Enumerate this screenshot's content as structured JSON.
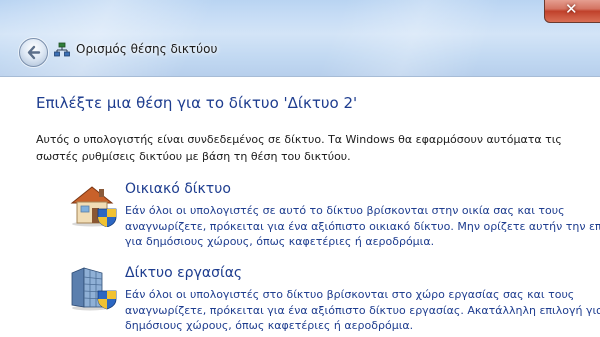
{
  "window": {
    "title": "Ορισμός θέσης δικτύου",
    "close_glyph": "✕"
  },
  "icons": {
    "back": "back-arrow-icon",
    "network": "network-icon",
    "home": "house-icon",
    "work": "office-building-icon",
    "shield": "security-shield-icon"
  },
  "main": {
    "heading": "Επιλέξτε μια θέση για το δίκτυο 'Δίκτυο  2'",
    "description": "Αυτός ο υπολογιστής είναι συνδεδεμένος σε δίκτυο. Τα Windows θα εφαρμόσουν αυτόματα τις σωστές ρυθμίσεις δικτύου με βάση τη θέση του δικτύου.",
    "options": [
      {
        "title": "Οικιακό δίκτυο",
        "lines": [
          "Εάν όλοι οι υπολογιστές σε αυτό το δίκτυο βρίσκονται στην οικία σας και τους",
          "αναγνωρίζετε, πρόκειται για ένα αξιόπιστο οικιακό δίκτυο. Μην ορίζετε αυτήν την επιλογή",
          "για δημόσιους χώρους, όπως καφετέριες ή αεροδρόμια."
        ]
      },
      {
        "title": "Δίκτυο εργασίας",
        "lines": [
          "Εάν όλοι οι υπολογιστές στο δίκτυο βρίσκονται στο χώρο εργασίας σας και τους",
          "αναγνωρίζετε, πρόκειται για ένα αξιόπιστο δίκτυο εργασίας. Ακατάλληλη επιλογή για",
          "δημόσιους χώρους, όπως καφετέριες ή αεροδρόμια."
        ]
      }
    ]
  },
  "colors": {
    "link_blue": "#1e3d8f",
    "glass": "#c6dcf5",
    "close_red": "#c0412b"
  }
}
